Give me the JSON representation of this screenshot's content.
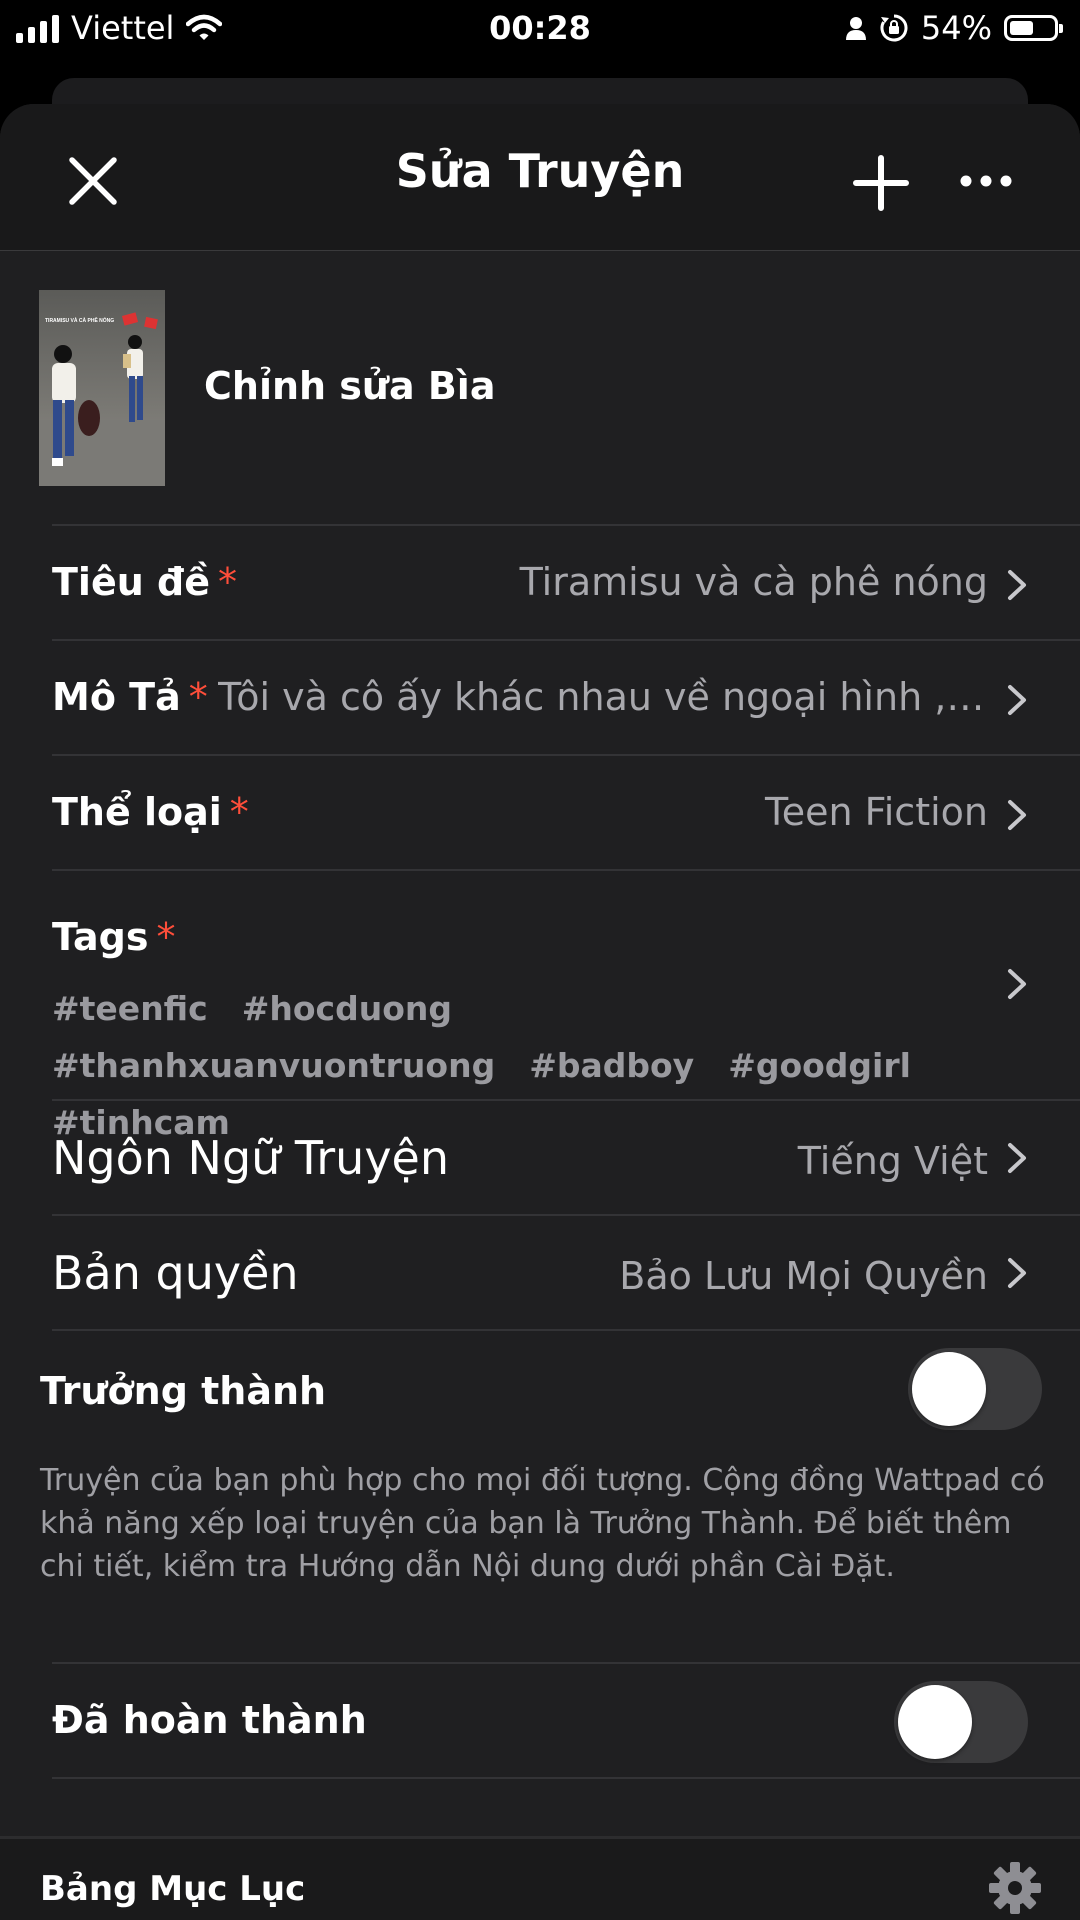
{
  "status_bar": {
    "carrier": "Viettel",
    "time": "00:28",
    "battery": "54%",
    "battery_level": 0.54,
    "icons": [
      "signal-icon",
      "wifi-icon",
      "person-icon",
      "rotation-lock-icon",
      "battery-icon"
    ]
  },
  "header": {
    "title": "Sửa Truyện",
    "close_icon": "close-icon",
    "add_icon": "plus-icon",
    "more_icon": "more-icon"
  },
  "cover": {
    "label": "Chỉnh sửa Bìa",
    "cover_text": "TIRAMISU VÀ CÀ PHÊ NÓNG"
  },
  "fields": {
    "title": {
      "label": "Tiêu đề",
      "required": "*",
      "value": "Tiramisu và cà phê nóng"
    },
    "description": {
      "label": "Mô Tả",
      "required": "*",
      "value": "Tôi và cô ấy khác nhau về ngoại hình , tính…"
    },
    "genre": {
      "label": "Thể loại",
      "required": "*",
      "value": "Teen Fiction"
    },
    "tags": {
      "label": "Tags",
      "required": "*",
      "items": [
        "#teenfic",
        "#hocduong",
        "#thanhxuanvuontruong",
        "#badboy",
        "#goodgirl",
        "#tinhcam"
      ]
    },
    "language": {
      "label": "Ngôn Ngữ Truyện",
      "value": "Tiếng Việt"
    },
    "copyright": {
      "label": "Bản quyền",
      "value": "Bảo Lưu Mọi Quyền"
    }
  },
  "mature": {
    "label": "Trưởng thành",
    "enabled": false,
    "description": "Truyện của bạn phù hợp cho mọi đối tượng. Cộng đồng Wattpad có khả năng xếp loại truyện của bạn là Trưởng Thành. Để biết thêm chi tiết, kiểm tra Hướng dẫn Nội dung dưới phần Cài Đặt."
  },
  "completed": {
    "label": "Đã hoàn thành",
    "enabled": false
  },
  "table_of_contents": {
    "label": "Bảng Mục Lục",
    "icon": "gear-icon"
  },
  "colors": {
    "background": "#1f1f21",
    "required_marker": "#ff4e3a",
    "secondary_text": "#a8a8ad",
    "toggle_off": "#3a3a3c"
  }
}
